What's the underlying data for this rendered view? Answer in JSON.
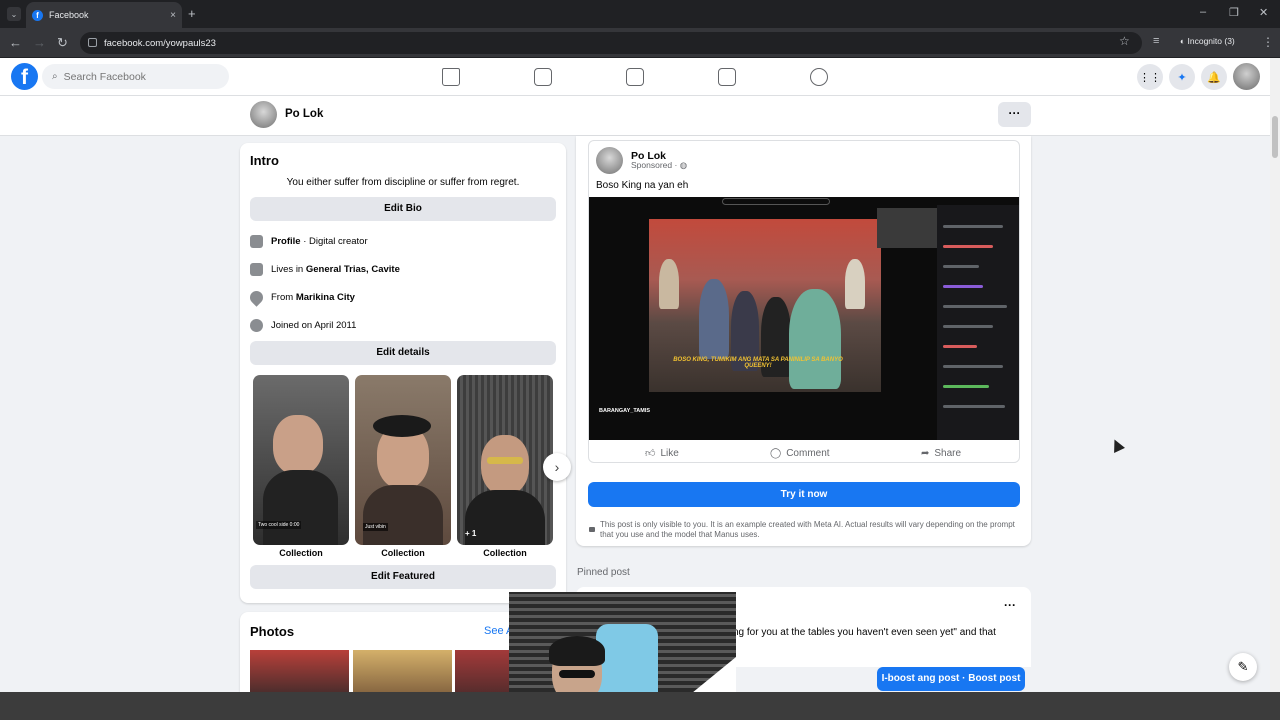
{
  "browser": {
    "tab_title": "Facebook",
    "url": "facebook.com/yowpauls23",
    "incognito_label": "Incognito (3)",
    "new_tab_glyph": "+",
    "close_glyph": "×"
  },
  "header": {
    "logo_letter": "f",
    "search_placeholder": "Search Facebook",
    "nav_icons": [
      "home-icon",
      "feeds-icon",
      "video-icon",
      "marketplace-icon",
      "groups-icon"
    ],
    "right_icons": [
      "menu-grid-icon",
      "messenger-icon",
      "notifications-icon",
      "account-avatar"
    ]
  },
  "profile": {
    "name": "Po Lok",
    "more_glyph": "···"
  },
  "intro": {
    "title": "Intro",
    "bio": "You either suffer from discipline or suffer from regret.",
    "edit_bio": "Edit Bio",
    "profile_label": "Profile",
    "profile_value": " · Digital creator",
    "lives_prefix": "Lives in ",
    "lives_value": "General Trias, Cavite",
    "from_prefix": "From ",
    "from_value": "Marikina City",
    "joined": "Joined on April 2011",
    "edit_details": "Edit details",
    "collections": [
      {
        "label": "Collection",
        "overlay": "Two cool side 0:00"
      },
      {
        "label": "Collection",
        "overlay": "Just vibin"
      },
      {
        "label": "Collection",
        "overlay": "+ 1"
      }
    ],
    "edit_featured": "Edit Featured"
  },
  "photos": {
    "title": "Photos",
    "see_all": "See A"
  },
  "post": {
    "author": "Po Lok",
    "sponsored": "Sponsored ·",
    "text": "Boso King na yan eh",
    "video_caption": "BOSO KING, TUMIKIM ANG MATA SA PANINILIP SA BANYO QUEENY!",
    "streamer": "BARANGAY_TAMIS",
    "like": "Like",
    "comment": "Comment",
    "share": "Share",
    "try_button": "Try it now",
    "notice": "This post is only visible to you. It is an example created with Meta AI. Actual results will vary depending on the prompt that you use and the model that Manus uses."
  },
  "pinned": {
    "label": "Pinned post",
    "text": "ng for you at the tables you haven't even seen yet\" and that",
    "more_glyph": "···",
    "boost_button": "I-boost ang post · Boost post"
  },
  "colors": {
    "accent": "#1877f2",
    "page_bg": "#f0f2f5"
  }
}
